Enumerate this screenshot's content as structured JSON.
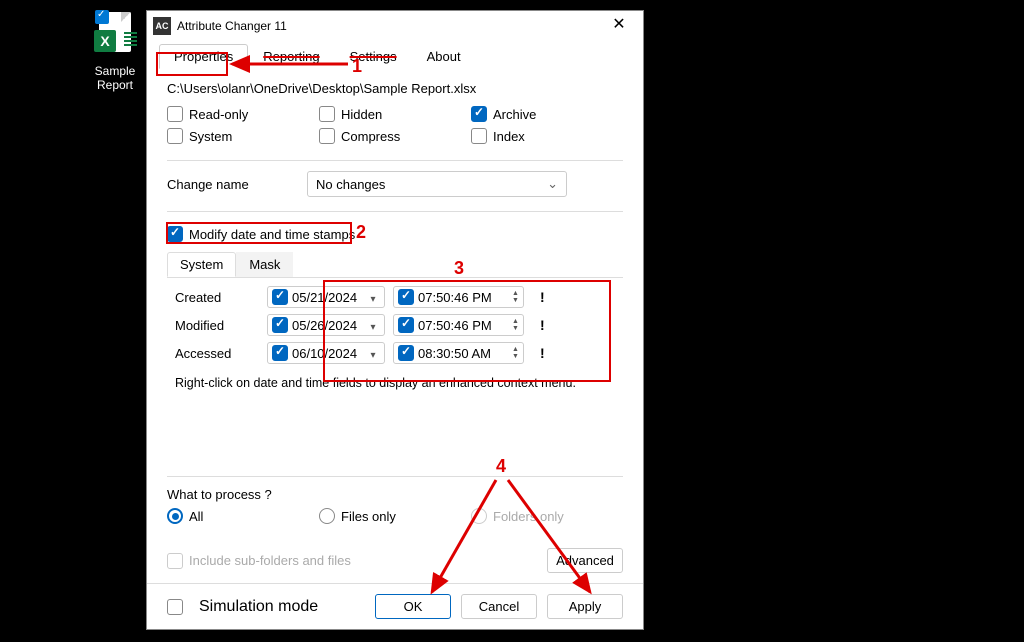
{
  "desktop": {
    "file_label": "Sample Report",
    "xls_letter": "X"
  },
  "window": {
    "title": "Attribute Changer 11",
    "app_badge": "AC",
    "tabs": {
      "properties": "Properties",
      "reporting": "Reporting",
      "settings": "Settings",
      "about": "About"
    },
    "filepath": "C:\\Users\\olanr\\OneDrive\\Desktop\\Sample Report.xlsx",
    "attrs": {
      "readonly": "Read-only",
      "system": "System",
      "hidden": "Hidden",
      "compress": "Compress",
      "archive": "Archive",
      "index": "Index"
    },
    "change_name_label": "Change name",
    "change_name_value": "No changes",
    "modify_stamps_label": "Modify date and time stamps",
    "subtabs": {
      "system": "System",
      "mask": "Mask"
    },
    "rows": {
      "created": {
        "label": "Created",
        "date": "05/21/2024",
        "time": "07:50:46  PM"
      },
      "modified": {
        "label": "Modified",
        "date": "05/26/2024",
        "time": "07:50:46  PM"
      },
      "accessed": {
        "label": "Accessed",
        "date": "06/10/2024",
        "time": "08:30:50  AM"
      }
    },
    "hint": "Right-click on date and time fields to display an enhanced context menu.",
    "process_label": "What to process ?",
    "process": {
      "all": "All",
      "files": "Files only",
      "folders": "Folders only"
    },
    "include_sub": "Include sub-folders and files",
    "advanced": "Advanced",
    "simulation": "Simulation mode",
    "buttons": {
      "ok": "OK",
      "cancel": "Cancel",
      "apply": "Apply"
    }
  },
  "annotations": {
    "n1": "1",
    "n2": "2",
    "n3": "3",
    "n4": "4"
  }
}
